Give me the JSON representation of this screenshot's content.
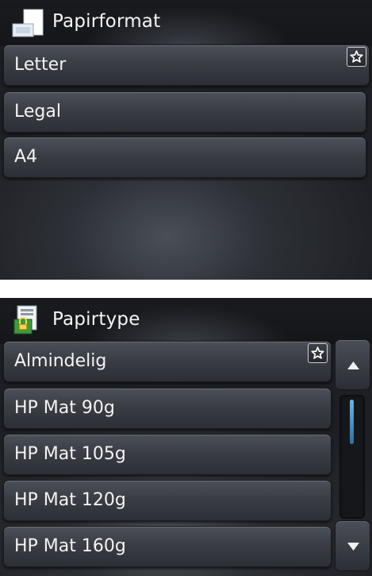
{
  "paper_size": {
    "title": "Papirformat",
    "icon": "paper-size-icon",
    "items": [
      {
        "label": "Letter",
        "favorite": true
      },
      {
        "label": "Legal",
        "favorite": false
      },
      {
        "label": "A4",
        "favorite": false
      }
    ]
  },
  "paper_type": {
    "title": "Papirtype",
    "icon": "paper-type-icon",
    "items": [
      {
        "label": "Almindelig",
        "favorite": true
      },
      {
        "label": "HP Mat 90g",
        "favorite": false
      },
      {
        "label": "HP Mat 105g",
        "favorite": false
      },
      {
        "label": "HP Mat 120g",
        "favorite": false
      },
      {
        "label": "HP Mat 160g",
        "favorite": false
      }
    ],
    "scrollbar": {
      "up_icon": "arrow-up-icon",
      "down_icon": "arrow-down-icon",
      "scroll_position": 0.0,
      "accent": "#4ea3d9"
    }
  },
  "favorite_icon": "star-icon"
}
